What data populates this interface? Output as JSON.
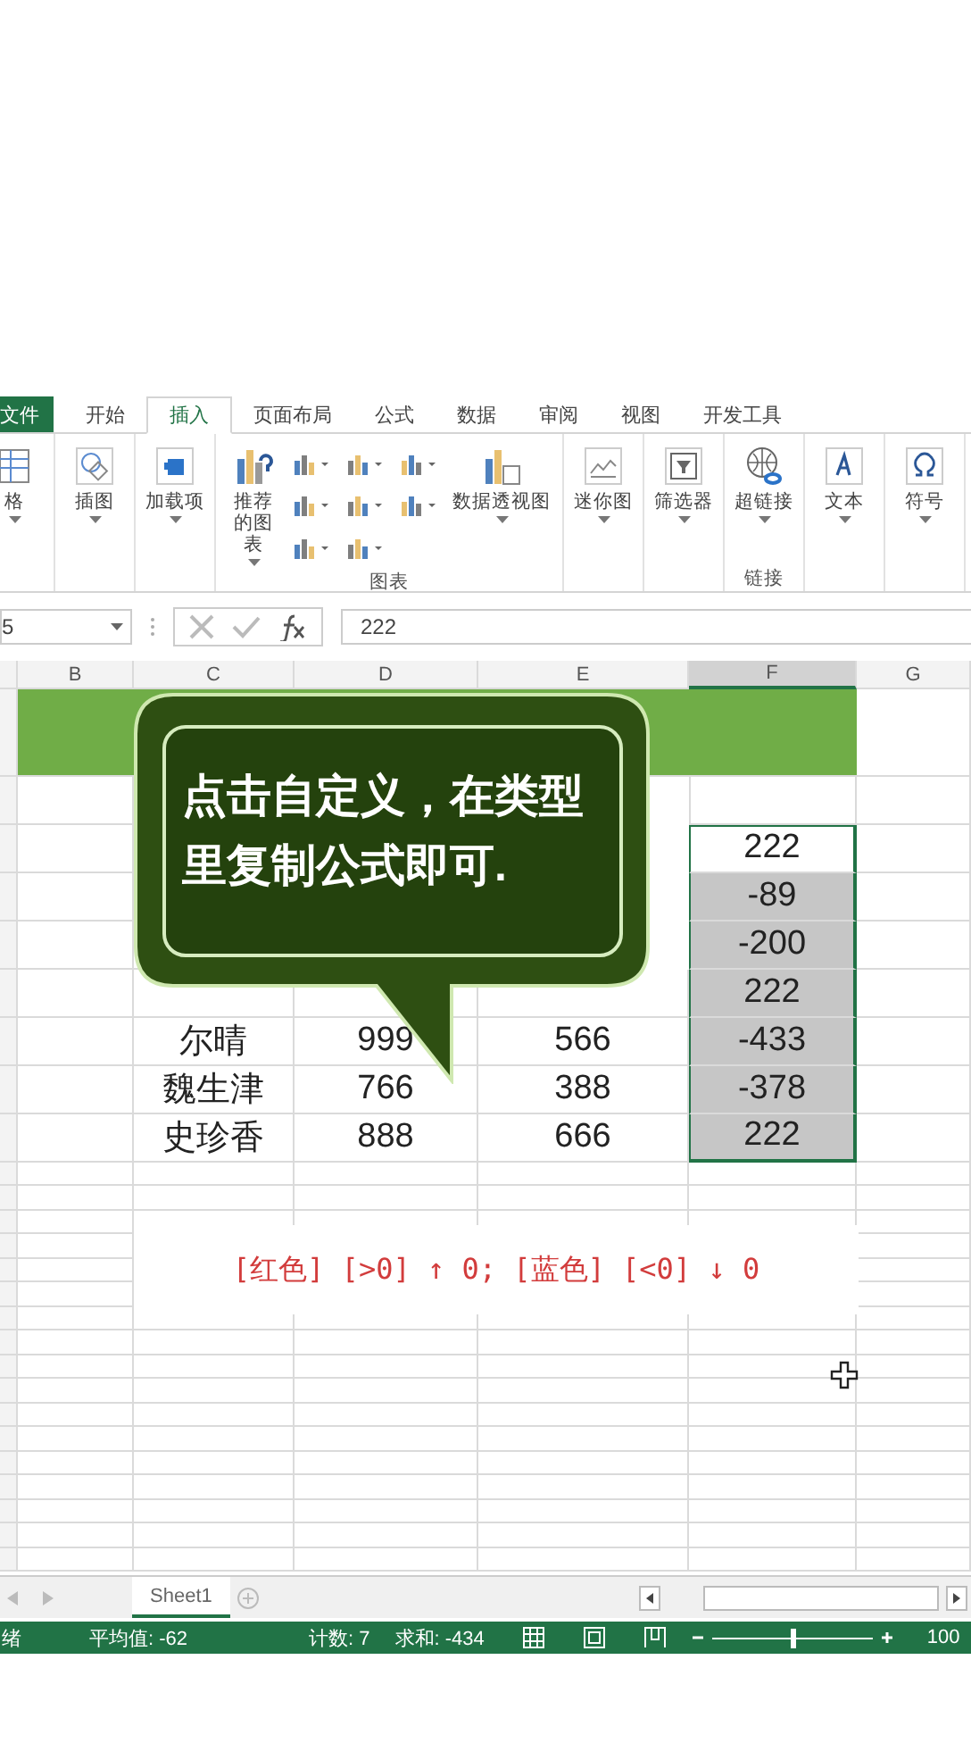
{
  "ribbon": {
    "tabs": [
      {
        "label": "文件",
        "kind": "file",
        "selected": false
      },
      {
        "label": "开始",
        "kind": "tab",
        "selected": false
      },
      {
        "label": "插入",
        "kind": "tab",
        "selected": true
      },
      {
        "label": "页面布局",
        "kind": "tab",
        "selected": false
      },
      {
        "label": "公式",
        "kind": "tab",
        "selected": false
      },
      {
        "label": "数据",
        "kind": "tab",
        "selected": false
      },
      {
        "label": "审阅",
        "kind": "tab",
        "selected": false
      },
      {
        "label": "视图",
        "kind": "tab",
        "selected": false
      },
      {
        "label": "开发工具",
        "kind": "tab",
        "selected": false
      }
    ],
    "groups": [
      {
        "buttons": [
          {
            "kind": "table",
            "label": "格"
          }
        ]
      },
      {
        "buttons": [
          {
            "kind": "illustration",
            "label": "插图"
          }
        ]
      },
      {
        "buttons": [
          {
            "kind": "addin",
            "label": "加载项"
          }
        ]
      },
      {
        "label": "图表",
        "buttons": [
          {
            "kind": "recommended",
            "label": "推荐的图表"
          },
          {
            "kind": "gallery"
          },
          {
            "kind": "pivot",
            "label": "数据透视图"
          }
        ]
      },
      {
        "buttons": [
          {
            "kind": "sparkline",
            "label": "迷你图"
          }
        ]
      },
      {
        "buttons": [
          {
            "kind": "slicer",
            "label": "筛选器"
          }
        ]
      },
      {
        "label": "链接",
        "buttons": [
          {
            "kind": "link",
            "label": "超链接"
          }
        ]
      },
      {
        "buttons": [
          {
            "kind": "text",
            "label": "文本"
          }
        ]
      },
      {
        "buttons": [
          {
            "kind": "symbol",
            "label": "符号"
          }
        ]
      }
    ]
  },
  "formula_bar": {
    "name_box": "5",
    "value": "222"
  },
  "sheet": {
    "columns": [
      {
        "label": "B",
        "selected": false
      },
      {
        "label": "C",
        "selected": false
      },
      {
        "label": "D",
        "selected": false
      },
      {
        "label": "E",
        "selected": false
      },
      {
        "label": "F",
        "selected": true
      },
      {
        "label": "G",
        "selected": false
      }
    ],
    "rows": [
      {
        "col_f": "222",
        "active": true
      },
      {
        "col_f": "-89",
        "active": false
      },
      {
        "col_f": "-200",
        "active": false
      },
      {
        "col_f": "222",
        "active": false
      },
      {
        "name": "尔晴",
        "col_d": "999",
        "col_e": "566",
        "col_f": "-433",
        "active": false
      },
      {
        "name": "魏生津",
        "col_d": "766",
        "col_e": "388",
        "col_f": "-378",
        "active": false
      },
      {
        "name": "史珍香",
        "col_d": "888",
        "col_e": "666",
        "col_f": "222",
        "active": false
      }
    ]
  },
  "callout": {
    "text": "点击自定义，在类型里复制公式即可."
  },
  "format_code": "[红色] [>0] ↑ 0; [蓝色] [<0] ↓ 0",
  "sheet_tabs": [
    {
      "label": "Sheet1",
      "selected": true
    }
  ],
  "status_bar": {
    "ready": "绪",
    "average": "平均值: -62",
    "count": "计数: 7",
    "sum": "求和: -434",
    "zoom": "100",
    "level": 0.5
  }
}
